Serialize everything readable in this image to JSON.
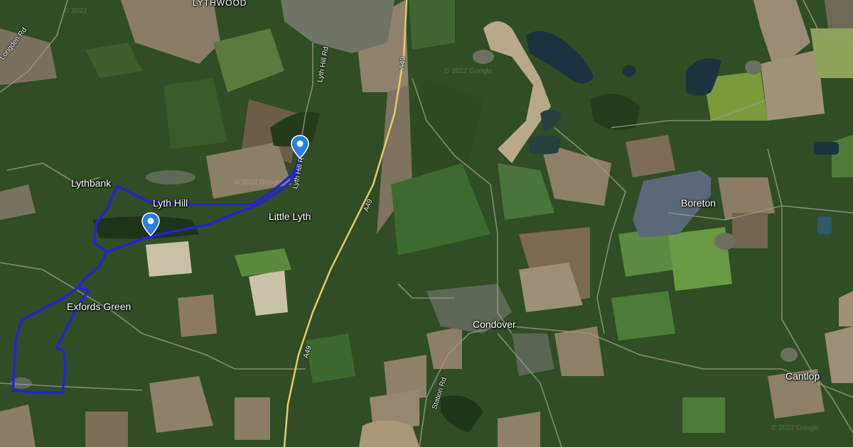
{
  "map": {
    "type": "satellite",
    "colors": {
      "route": "#2323d8",
      "pin": "#2a7de1",
      "a_road": "#e8c86a",
      "water": "#1c3440"
    }
  },
  "places": {
    "lythwood": "LYTHWOOD",
    "lythbank": "Lythbank",
    "lyth_hill": "Lyth Hill",
    "little_lyth": "Little Lyth",
    "boreton": "Boreton",
    "exfords_green": "Exfords Green",
    "condover": "Condover",
    "cantlop": "Cantlop"
  },
  "roads": {
    "longden_rd": "Longden Rd",
    "lyth_hill_rd_north": "Lyth Hill Rd",
    "lyth_hill_rd_south": "Lyth Hill R",
    "a49_north": "A49",
    "a49_mid": "A49",
    "a49_south": "A49",
    "station_rd": "Station Rd"
  },
  "watermarks": [
    "© 2022",
    "© 2022 Google",
    "© 2022 Google",
    "© 2022 Google"
  ],
  "markers": [
    {
      "name": "route-start-pin",
      "icon": "map-pin-icon"
    },
    {
      "name": "route-waypoint-pin",
      "icon": "map-pin-icon"
    }
  ]
}
